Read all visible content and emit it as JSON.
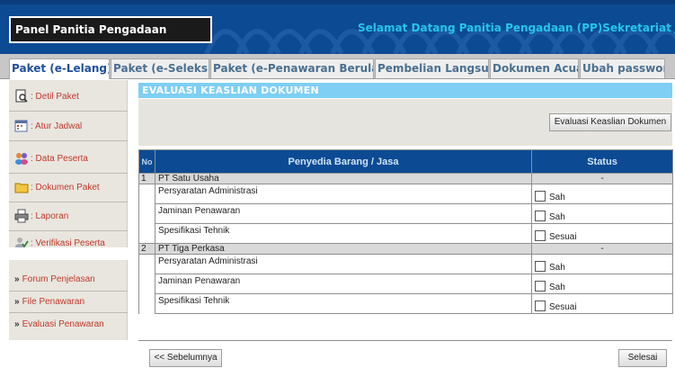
{
  "header": {
    "panel_title": "Panel Panitia Pengadaan",
    "welcome": "Selamat Datang Panitia Pengadaan (PP)Sekretariat Jendera"
  },
  "tabs": [
    {
      "label": "Paket (e-Lelang)",
      "active": true
    },
    {
      "label": "Paket (e-Seleksi)",
      "active": false
    },
    {
      "label": "Paket (e-Penawaran Berulang)",
      "active": false
    },
    {
      "label": "Pembelian Langsung",
      "active": false
    },
    {
      "label": "Dokumen Acuan",
      "active": false
    },
    {
      "label": "Ubah password",
      "active": false
    }
  ],
  "sidebar": {
    "items": [
      {
        "label": ": Detil Paket",
        "icon": "document-search-icon"
      },
      {
        "label": ": Atur Jadwal",
        "icon": "calendar-icon"
      },
      {
        "label": ": Data Peserta",
        "icon": "users-icon"
      },
      {
        "label": ": Dokumen Paket",
        "icon": "folder-icon"
      },
      {
        "label": ": Laporan",
        "icon": "printer-icon"
      },
      {
        "label": ": Verifikasi Peserta",
        "icon": "verify-icon"
      }
    ],
    "links": [
      {
        "label": "Forum Penjelasan",
        "arrow": "»"
      },
      {
        "label": "File Penawaran",
        "arrow": "»"
      },
      {
        "label": "Evaluasi Penawaran",
        "arrow": "»"
      }
    ]
  },
  "main": {
    "title": "EVALUASI KEASLIAN DOKUMEN",
    "eval_button": "Evaluasi Keaslian Dokumen",
    "table": {
      "headers": {
        "no": "No",
        "provider": "Penyedia Barang / Jasa",
        "status": "Status"
      },
      "groups": [
        {
          "no": "1",
          "name": "PT Satu Usaha",
          "status": "-",
          "rows": [
            {
              "label": "Persyaratan Administrasi",
              "check": "Sah"
            },
            {
              "label": "Jaminan Penawaran",
              "check": "Sah"
            },
            {
              "label": "Spesifikasi Tehnik",
              "check": "Sesuai"
            }
          ]
        },
        {
          "no": "2",
          "name": "PT Tiga Perkasa",
          "status": "-",
          "rows": [
            {
              "label": "Persyaratan Administrasi",
              "check": "Sah"
            },
            {
              "label": "Jaminan Penawaran",
              "check": "Sah"
            },
            {
              "label": "Spesifikasi Tehnik",
              "check": "Sesuai"
            }
          ]
        }
      ]
    },
    "prev_button": "<< Sebelumnya",
    "done_button": "Selesai"
  },
  "colors": {
    "header_bg": "#0c4a93",
    "welcome_text": "#24c6e8",
    "title_bar": "#7ecff3",
    "sidebar_text": "#c0392b",
    "table_header": "#0c4a93"
  }
}
